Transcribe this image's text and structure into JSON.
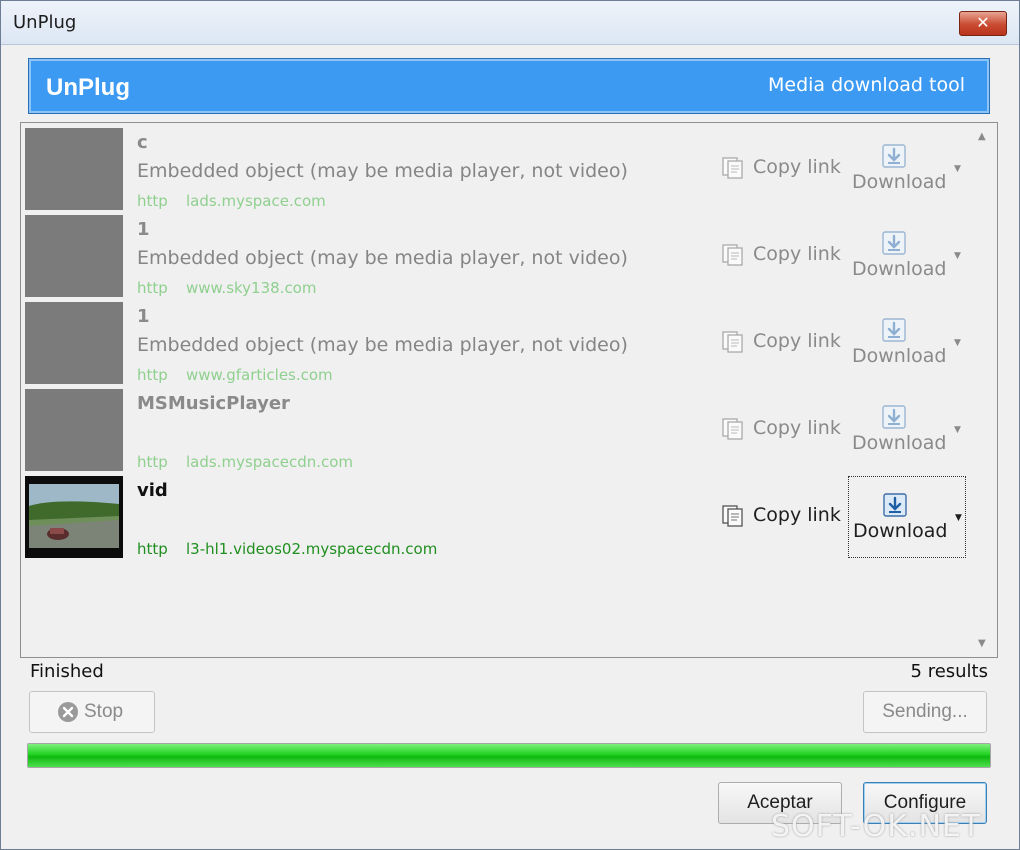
{
  "window": {
    "title": "UnPlug",
    "close_symbol": "✕"
  },
  "banner": {
    "app_name": "UnPlug",
    "tagline": "Media download tool",
    "color": "#3c9af3"
  },
  "results": [
    {
      "name": "c",
      "description": "Embedded object (may be media player, not video)",
      "protocol": "http",
      "host": "lads.myspace.com",
      "thumbnail": "gray-placeholder",
      "copy_label": "Copy link",
      "download_label": "Download",
      "active": false
    },
    {
      "name": "1",
      "description": "Embedded object (may be media player, not video)",
      "protocol": "http",
      "host": "www.sky138.com",
      "thumbnail": "gray-placeholder",
      "copy_label": "Copy link",
      "download_label": "Download",
      "active": false
    },
    {
      "name": "1",
      "description": "Embedded object (may be media player, not video)",
      "protocol": "http",
      "host": "www.gfarticles.com",
      "thumbnail": "gray-placeholder",
      "copy_label": "Copy link",
      "download_label": "Download",
      "active": false
    },
    {
      "name": "MSMusicPlayer",
      "description": "",
      "protocol": "http",
      "host": "lads.myspacecdn.com",
      "thumbnail": "gray-placeholder",
      "copy_label": "Copy link",
      "download_label": "Download",
      "active": false
    },
    {
      "name": "vid",
      "description": "",
      "protocol": "http",
      "host": "l3-hl1.videos02.myspacecdn.com",
      "thumbnail": "video-frame",
      "copy_label": "Copy link",
      "download_label": "Download",
      "active": true
    }
  ],
  "status": {
    "left": "Finished",
    "right": "5 results"
  },
  "buttons": {
    "stop": "Stop",
    "sending": "Sending...",
    "accept": "Aceptar",
    "configure": "Configure"
  },
  "progress": {
    "fraction": 1.0,
    "color": "#22d322"
  },
  "watermark": "SOFT-OK.NET"
}
